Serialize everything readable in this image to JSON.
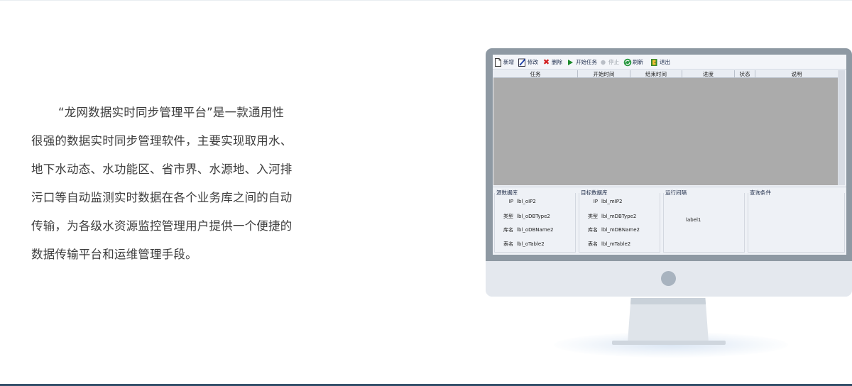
{
  "description": {
    "lines": [
      "“龙网数据实时同步管理平台”是一款通用性",
      "很强的数据实时同步管理软件，主要实现取用水、",
      "地下水动态、水功能区、省市界、水源地、入河排",
      "污口等自动监测实时数据在各个业务库之间的自动",
      "传输，为各级水资源监控管理用户提供一个便捷的",
      "数据传输平台和运维管理手段。"
    ]
  },
  "app": {
    "toolbar": {
      "new": {
        "label": "新增",
        "icon": "new-document-icon"
      },
      "edit": {
        "label": "修改",
        "icon": "edit-icon"
      },
      "delete": {
        "label": "删除",
        "icon": "delete-x-icon"
      },
      "start": {
        "label": "开始任务",
        "icon": "play-icon"
      },
      "stop": {
        "label": "停止",
        "icon": "stop-icon"
      },
      "refresh": {
        "label": "刷新",
        "icon": "refresh-icon"
      },
      "exit": {
        "label": "退出",
        "icon": "exit-icon"
      }
    },
    "grid": {
      "columns": [
        "任务",
        "开始时间",
        "结束时间",
        "进度",
        "状态",
        "说明"
      ]
    },
    "source": {
      "title": "源数据库",
      "rows": [
        {
          "key": "IP",
          "value": "lbl_oIP2"
        },
        {
          "key": "类型",
          "value": "lbl_oDBType2"
        },
        {
          "key": "库名",
          "value": "lbl_oDBName2"
        },
        {
          "key": "表名",
          "value": "lbl_oTable2"
        }
      ]
    },
    "target": {
      "title": "目标数据库",
      "rows": [
        {
          "key": "IP",
          "value": "lbl_mIP2"
        },
        {
          "key": "类型",
          "value": "lbl_mDBType2"
        },
        {
          "key": "库名",
          "value": "lbl_mDBName2"
        },
        {
          "key": "表名",
          "value": "lbl_mTable2"
        }
      ]
    },
    "interval": {
      "title": "运行间隔",
      "value": "label1"
    },
    "query": {
      "title": "查询条件"
    }
  },
  "colors": {
    "accent_bar": "#34506a",
    "bezel": "#8e99a3",
    "grid_background": "#ababab"
  }
}
